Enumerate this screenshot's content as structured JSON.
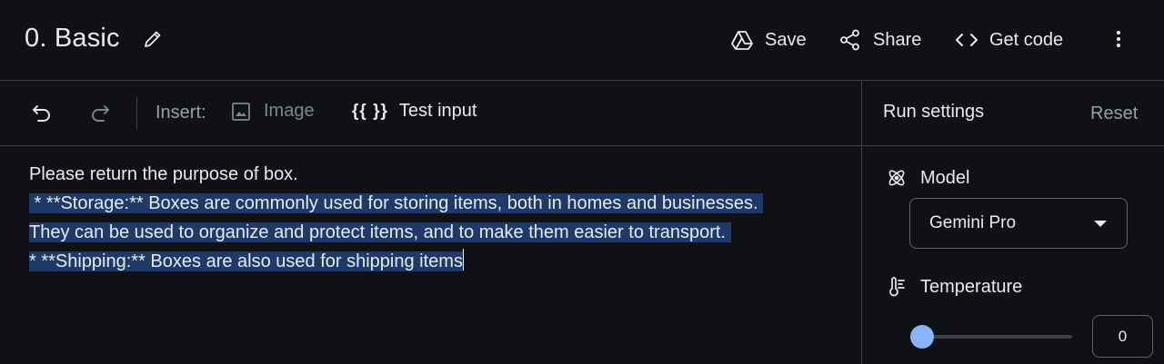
{
  "header": {
    "title": "0. Basic",
    "actions": [
      {
        "label": "Save",
        "icon": "drive-icon"
      },
      {
        "label": "Share",
        "icon": "share-icon"
      },
      {
        "label": "Get code",
        "icon": "code-icon"
      }
    ],
    "more_icon": "more-vert-icon"
  },
  "toolbar": {
    "insert_label": "Insert:",
    "image_label": "Image",
    "test_input_braces": "{{ }}",
    "test_input_label": "Test input"
  },
  "editor": {
    "lines": [
      "Please return the purpose of box.",
      " * **Storage:** Boxes are commonly used for storing items, both in homes and businesses. ",
      "They can be used to organize and protect items, and to make them easier to transport. ",
      "* **Shipping:** Boxes are also used for shipping items"
    ],
    "selection_color": "#1f3a68"
  },
  "run_settings": {
    "title": "Run settings",
    "reset_label": "Reset",
    "model_label": "Model",
    "model_value": "Gemini Pro",
    "temperature_label": "Temperature",
    "temperature_value": "0",
    "accent": "#8ab4f8"
  }
}
